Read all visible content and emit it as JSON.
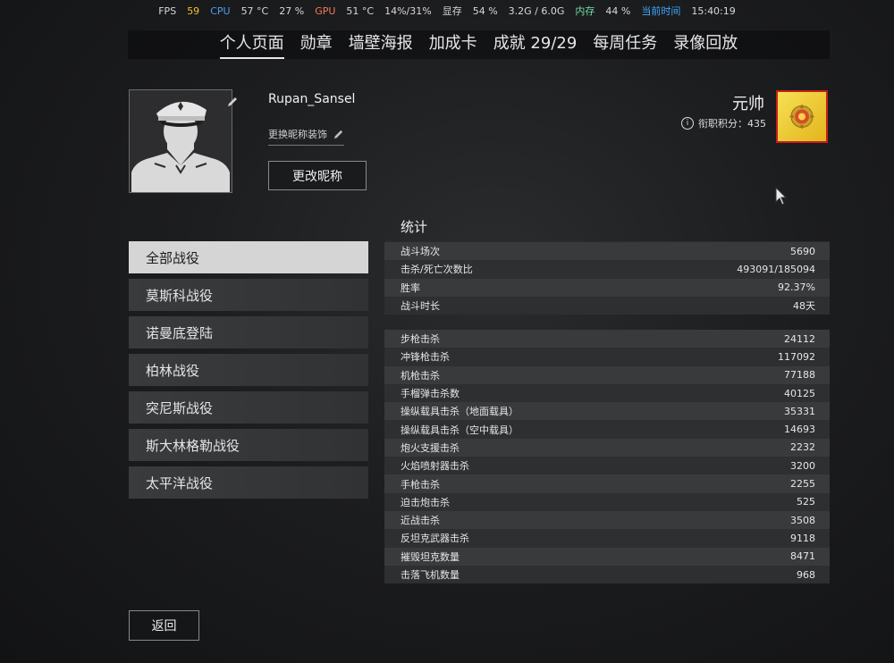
{
  "overlay": {
    "fps_label": "FPS",
    "fps_value": "59",
    "cpu_label": "CPU",
    "cpu_temp": "57 °C",
    "cpu_load": "27 %",
    "gpu_label": "GPU",
    "gpu_temp": "51 °C",
    "gpu_load": "14%/31%",
    "vram_label": "显存",
    "vram_pct": "54 %",
    "vram_amount": "3.2G / 6.0G",
    "mem_label": "内存",
    "mem_pct": "44 %",
    "time_label": "当前时间",
    "time_value": "15:40:19"
  },
  "nav": {
    "tabs": [
      {
        "label": "个人页面"
      },
      {
        "label": "勋章"
      },
      {
        "label": "墙壁海报"
      },
      {
        "label": "加成卡"
      },
      {
        "label": "成就 29/29"
      },
      {
        "label": "每周任务"
      },
      {
        "label": "录像回放"
      }
    ]
  },
  "profile": {
    "username": "Rupan_Sansel",
    "rename_decoration": "更换昵称装饰",
    "rename_button": "更改昵称",
    "rank_title": "元帅",
    "rank_points": "衔职积分：435"
  },
  "sidebar": {
    "items": [
      {
        "label": "全部战役"
      },
      {
        "label": "莫斯科战役"
      },
      {
        "label": "诺曼底登陆"
      },
      {
        "label": "柏林战役"
      },
      {
        "label": "突尼斯战役"
      },
      {
        "label": "斯大林格勒战役"
      },
      {
        "label": "太平洋战役"
      }
    ]
  },
  "stats": {
    "title": "统计",
    "general": [
      {
        "label": "战斗场次",
        "value": "5690"
      },
      {
        "label": "击杀/死亡次数比",
        "value": "493091/185094"
      },
      {
        "label": "胜率",
        "value": "92.37%"
      },
      {
        "label": "战斗时长",
        "value": "48天"
      }
    ],
    "kills": [
      {
        "label": "步枪击杀",
        "value": "24112"
      },
      {
        "label": "冲锋枪击杀",
        "value": "117092"
      },
      {
        "label": "机枪击杀",
        "value": "77188"
      },
      {
        "label": "手榴弹击杀数",
        "value": "40125"
      },
      {
        "label": "操纵载具击杀（地面载具）",
        "value": "35331"
      },
      {
        "label": "操纵载具击杀（空中载具）",
        "value": "14693"
      },
      {
        "label": "炮火支援击杀",
        "value": "2232"
      },
      {
        "label": "火焰喷射器击杀",
        "value": "3200"
      },
      {
        "label": "手枪击杀",
        "value": "2255"
      },
      {
        "label": "迫击炮击杀",
        "value": "525"
      },
      {
        "label": "近战击杀",
        "value": "3508"
      },
      {
        "label": "反坦克武器击杀",
        "value": "9118"
      },
      {
        "label": "摧毁坦克数量",
        "value": "8471"
      },
      {
        "label": "击落飞机数量",
        "value": "968"
      }
    ]
  },
  "footer": {
    "back_button": "返回"
  },
  "colors": {
    "badge_gold": "#f2d53c",
    "badge_border": "#c41f1a",
    "active_tab": "#d5d5d5"
  }
}
